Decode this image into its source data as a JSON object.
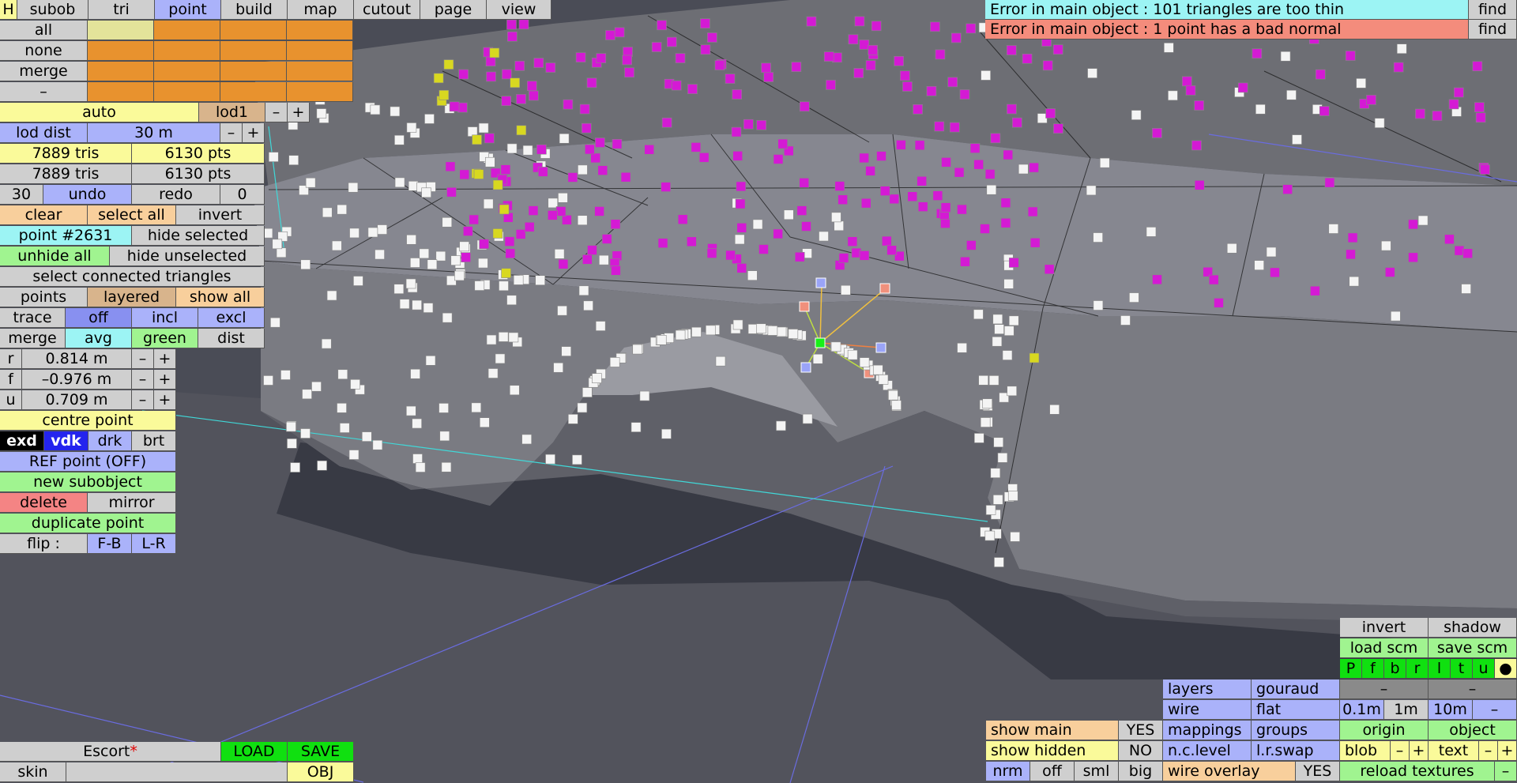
{
  "tabs": {
    "h": "H",
    "subob": "subob",
    "tri": "tri",
    "point": "point",
    "build": "build",
    "map": "map",
    "cutout": "cutout",
    "page": "page",
    "view": "view"
  },
  "select": {
    "all": "all",
    "none": "none",
    "merge": "merge",
    "dash": "–"
  },
  "lod": {
    "auto": "auto",
    "lod": "lod1",
    "minus": "–",
    "plus": "+",
    "dist_label": "lod dist",
    "dist_value": "30 m"
  },
  "stats": {
    "tris1": "7889 tris",
    "pts1": "6130 pts",
    "tris2": "7889 tris",
    "pts2": "6130 pts"
  },
  "undo": {
    "count": "30",
    "undo": "undo",
    "redo": "redo",
    "redo_count": "0"
  },
  "edit": {
    "clear": "clear",
    "select_all": "select all",
    "invert": "invert",
    "point_id": "point #2631",
    "hide_selected": "hide selected",
    "unhide_all": "unhide all",
    "hide_unselected": "hide unselected",
    "select_connected": "select connected triangles"
  },
  "display": {
    "points": "points",
    "layered": "layered",
    "show_all": "show all"
  },
  "trace": {
    "trace": "trace",
    "off": "off",
    "incl": "incl",
    "excl": "excl"
  },
  "mergeops": {
    "merge": "merge",
    "avg": "avg",
    "green": "green",
    "dist": "dist"
  },
  "coords": {
    "r_label": "r",
    "r_value": "0.814 m",
    "f_label": "f",
    "f_value": "–0.976 m",
    "u_label": "u",
    "u_value": "0.709 m",
    "minus": "–",
    "plus": "+"
  },
  "pointops": {
    "centre": "centre point",
    "exd": "exd",
    "vdk": "vdk",
    "drk": "drk",
    "brt": "brt",
    "ref": "REF point (OFF)",
    "new_subobject": "new subobject",
    "delete": "delete",
    "mirror": "mirror",
    "duplicate": "duplicate point",
    "flip": "flip :",
    "fb": "F-B",
    "lr": "L-R"
  },
  "errors": [
    {
      "text": "Error in main object : 101 triangles are too thin",
      "find": "find"
    },
    {
      "text": "Error in main object : 1 point has a bad normal",
      "find": "find"
    }
  ],
  "file": {
    "name": "Escort",
    "modified": "*",
    "load": "LOAD",
    "save": "SAVE",
    "skin": "skin",
    "obj": "OBJ"
  },
  "view": {
    "invert": "invert",
    "shadow": "shadow",
    "load_scm": "load scm",
    "save_scm": "save scm",
    "views": [
      "P",
      "f",
      "b",
      "r",
      "l",
      "t",
      "u",
      "●"
    ],
    "layers": "layers",
    "gouraud": "gouraud",
    "dash": "–",
    "wire": "wire",
    "flat": "flat",
    "s01": "0.1m",
    "s1": "1m",
    "s10": "10m",
    "mappings": "mappings",
    "groups": "groups",
    "origin": "origin",
    "object": "object",
    "nclevel": "n.c.level",
    "lrswap": "l.r.swap",
    "blob": "blob",
    "text": "text",
    "minus": "–",
    "plus": "+",
    "show_main": "show main",
    "show_main_val": "YES",
    "show_hidden": "show hidden",
    "show_hidden_val": "NO",
    "wire_overlay": "wire overlay",
    "wire_overlay_val": "YES",
    "reload": "reload textures",
    "nrm": "nrm",
    "off": "off",
    "sml": "sml",
    "big": "big"
  }
}
